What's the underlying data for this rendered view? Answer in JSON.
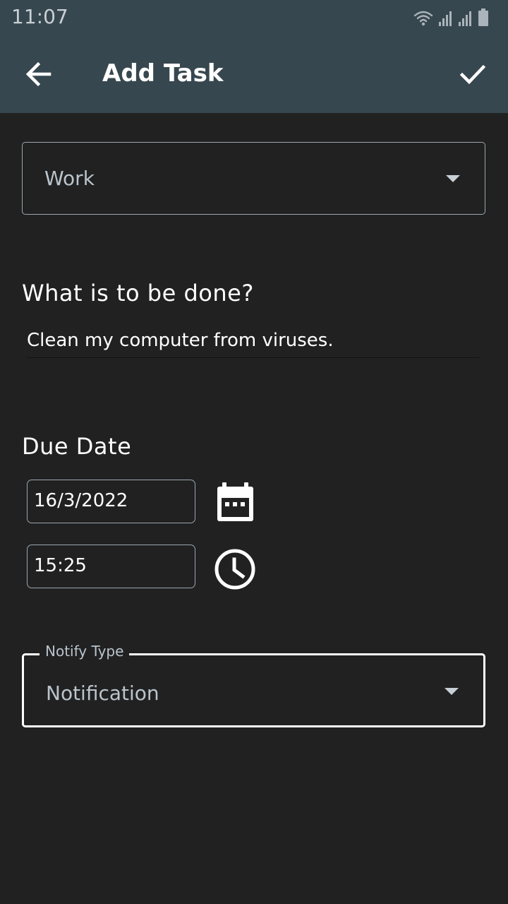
{
  "status_bar": {
    "time": "11:07",
    "icons": [
      "wifi-icon",
      "signal-icon",
      "signal-icon",
      "battery-icon"
    ]
  },
  "app_bar": {
    "title": "Add Task",
    "back_icon": "arrow-back-icon",
    "confirm_icon": "check-icon"
  },
  "category_dropdown": {
    "selected": "Work"
  },
  "task": {
    "heading": "What is to be done?",
    "value": "Clean my computer from viruses."
  },
  "due_date": {
    "heading": "Due Date",
    "date": "16/3/2022",
    "time": "15:25",
    "date_icon": "calendar-icon",
    "time_icon": "clock-icon"
  },
  "notify_type": {
    "label": "Notify Type",
    "selected": "Notification"
  },
  "colors": {
    "app_bar": "#37474f",
    "background": "#212121",
    "text": "#ffffff",
    "muted_text": "#b9c4cc"
  }
}
